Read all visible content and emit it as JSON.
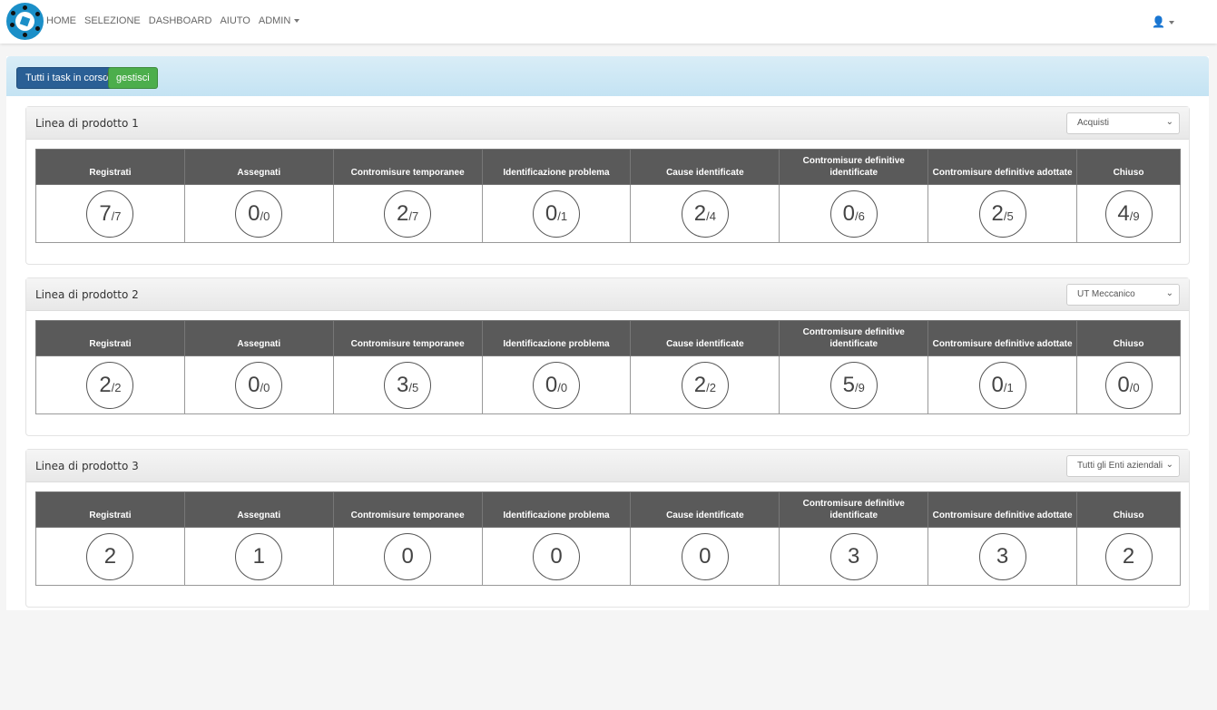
{
  "nav": {
    "items": [
      "HOME",
      "SELEZIONE",
      "DASHBOARD",
      "AIUTO",
      "ADMIN"
    ],
    "user_icon": "user-icon"
  },
  "breadcrumb": {
    "all": "Tutti i task in corso",
    "separator": "/",
    "current": "gestisci"
  },
  "columns": [
    "Registrati",
    "Assegnati",
    "Contromisure temporanee",
    "Identificazione problema",
    "Cause identificate",
    "Contromisure definitive identificate",
    "Contromisure definitive adottate",
    "Chiuso"
  ],
  "panels": [
    {
      "title": "Linea di prodotto 1",
      "filter": "Acquisti",
      "values": [
        [
          "7",
          "/7"
        ],
        [
          "0",
          "/0"
        ],
        [
          "2",
          "/7"
        ],
        [
          "0",
          "/1"
        ],
        [
          "2",
          "/4"
        ],
        [
          "0",
          "/6"
        ],
        [
          "2",
          "/5"
        ],
        [
          "4",
          "/9"
        ]
      ]
    },
    {
      "title": "Linea di prodotto 2",
      "filter": "UT Meccanico",
      "values": [
        [
          "2",
          "/2"
        ],
        [
          "0",
          "/0"
        ],
        [
          "3",
          "/5"
        ],
        [
          "0",
          "/0"
        ],
        [
          "2",
          "/2"
        ],
        [
          "5",
          "/9"
        ],
        [
          "0",
          "/1"
        ],
        [
          "0",
          "/0"
        ]
      ]
    },
    {
      "title": "Linea di prodotto 3",
      "filter": "Tutti gli Enti aziendali",
      "values": [
        [
          "2",
          ""
        ],
        [
          "1",
          ""
        ],
        [
          "0",
          ""
        ],
        [
          "0",
          ""
        ],
        [
          "0",
          ""
        ],
        [
          "3",
          ""
        ],
        [
          "3",
          ""
        ],
        [
          "2",
          ""
        ]
      ]
    }
  ]
}
